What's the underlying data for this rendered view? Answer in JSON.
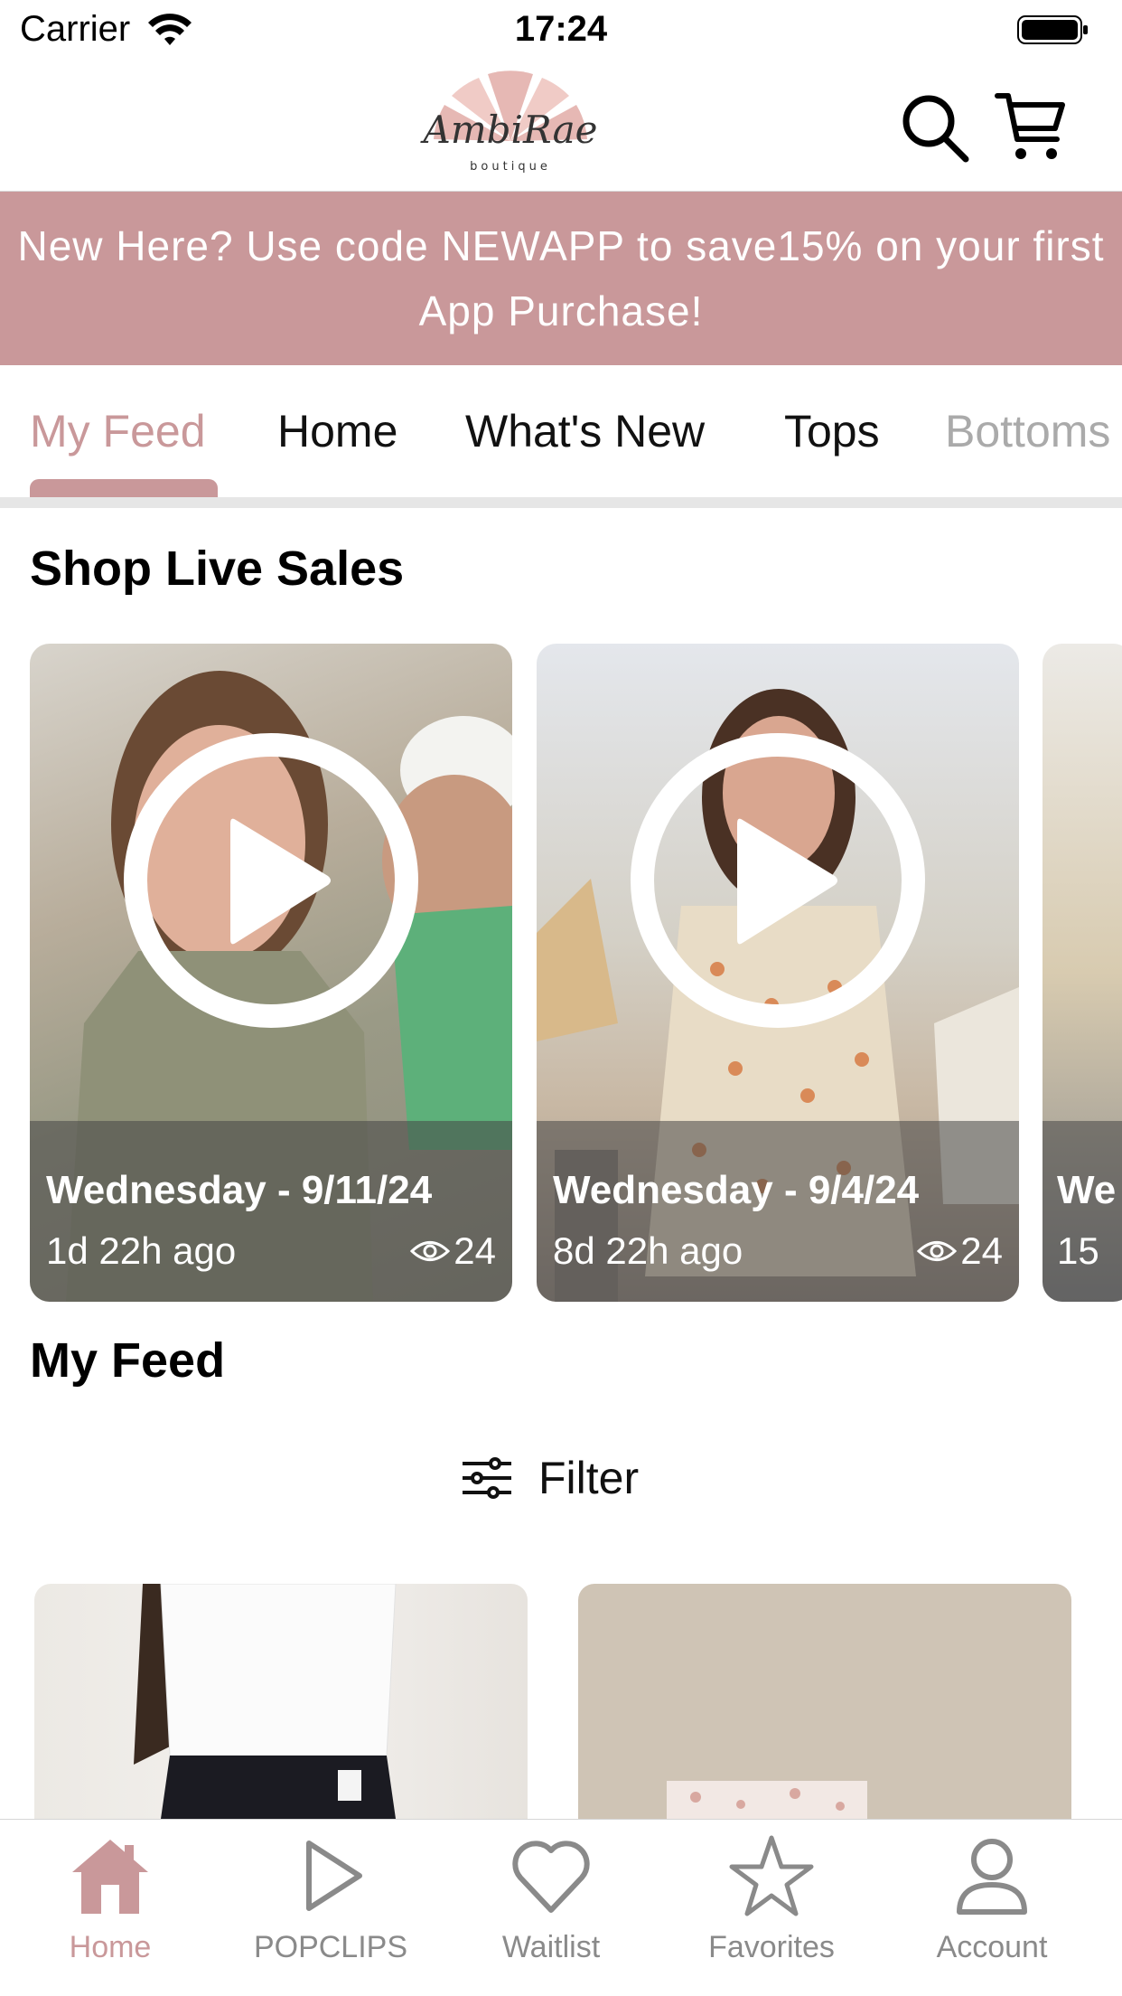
{
  "status_bar": {
    "carrier": "Carrier",
    "time": "17:24"
  },
  "header": {
    "logo_text": "AmbiRae",
    "logo_subtext": "boutique",
    "search_icon": "search-icon",
    "cart_icon": "cart-icon"
  },
  "promo": {
    "text": "New Here? Use code NEWAPP to save15% on your first App Purchase!"
  },
  "tabs": [
    {
      "label": "My Feed",
      "active": true
    },
    {
      "label": "Home"
    },
    {
      "label": "What's New"
    },
    {
      "label": "Tops"
    },
    {
      "label": "Bottoms"
    }
  ],
  "live_sales": {
    "title": "Shop Live Sales",
    "cards": [
      {
        "title": "Wednesday - 9/11/24",
        "ago": "1d 22h ago",
        "views": "24"
      },
      {
        "title": "Wednesday - 9/4/24",
        "ago": "8d 22h ago",
        "views": "24"
      },
      {
        "title": "We",
        "ago": "15"
      }
    ]
  },
  "feed": {
    "title": "My Feed",
    "filter_label": "Filter"
  },
  "tabbar": [
    {
      "label": "Home",
      "icon": "home-icon",
      "active": true
    },
    {
      "label": "POPCLIPS",
      "icon": "play-icon"
    },
    {
      "label": "Waitlist",
      "icon": "heart-icon"
    },
    {
      "label": "Favorites",
      "icon": "star-icon"
    },
    {
      "label": "Account",
      "icon": "user-icon"
    }
  ],
  "colors": {
    "accent": "#c9989a",
    "promo_bg": "#c9989a",
    "inactive": "#8a8a8a"
  }
}
